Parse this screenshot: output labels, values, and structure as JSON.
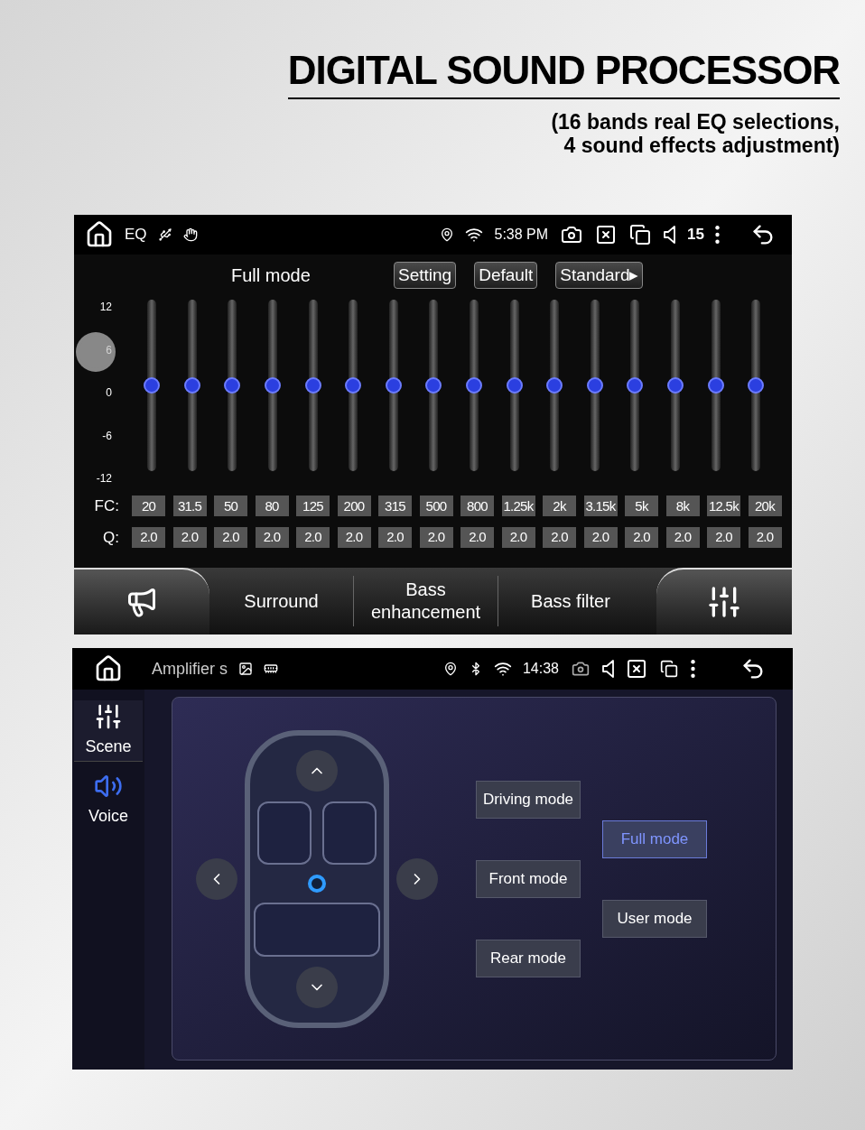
{
  "heading": {
    "title": "DIGITAL SOUND PROCESSOR",
    "subtitle_lines": [
      "(16 bands real EQ selections,",
      "4 sound effects adjustment)"
    ]
  },
  "eq_screen": {
    "status_bar": {
      "app": "EQ",
      "time": "5:38 PM",
      "volume": "15"
    },
    "mode": "Full mode",
    "buttons": [
      "Setting",
      "Default",
      "Standard▸"
    ],
    "scale": [
      "12",
      "6",
      "0",
      "-6",
      "-12"
    ],
    "fc_label": "FC:",
    "q_label": "Q:",
    "bands": [
      {
        "fc": "20",
        "q": "2.0",
        "level": 0.5
      },
      {
        "fc": "31.5",
        "q": "2.0",
        "level": 0.5
      },
      {
        "fc": "50",
        "q": "2.0",
        "level": 0.5
      },
      {
        "fc": "80",
        "q": "2.0",
        "level": 0.5
      },
      {
        "fc": "125",
        "q": "2.0",
        "level": 0.5
      },
      {
        "fc": "200",
        "q": "2.0",
        "level": 0.5
      },
      {
        "fc": "315",
        "q": "2.0",
        "level": 0.5
      },
      {
        "fc": "500",
        "q": "2.0",
        "level": 0.5
      },
      {
        "fc": "800",
        "q": "2.0",
        "level": 0.5
      },
      {
        "fc": "1.25k",
        "q": "2.0",
        "level": 0.5
      },
      {
        "fc": "2k",
        "q": "2.0",
        "level": 0.5
      },
      {
        "fc": "3.15k",
        "q": "2.0",
        "level": 0.5
      },
      {
        "fc": "5k",
        "q": "2.0",
        "level": 0.5
      },
      {
        "fc": "8k",
        "q": "2.0",
        "level": 0.5
      },
      {
        "fc": "12.5k",
        "q": "2.0",
        "level": 0.5
      },
      {
        "fc": "20k",
        "q": "2.0",
        "level": 0.5
      }
    ],
    "tabs": [
      "Surround",
      "Bass enhancement",
      "Bass filter"
    ]
  },
  "amp_screen": {
    "status_bar": {
      "app": "Amplifier s",
      "time": "14:38"
    },
    "sidebar": [
      {
        "label": "Scene",
        "kind": "sliders",
        "selected": true
      },
      {
        "label": "Voice",
        "kind": "speaker",
        "selected": false
      }
    ],
    "modes_left": [
      {
        "label": "Driving mode",
        "selected": false
      },
      {
        "label": "Front mode",
        "selected": false
      },
      {
        "label": "Rear mode",
        "selected": false
      }
    ],
    "modes_right": [
      {
        "label": "Full mode",
        "selected": true
      },
      {
        "label": "User mode",
        "selected": false
      }
    ]
  }
}
